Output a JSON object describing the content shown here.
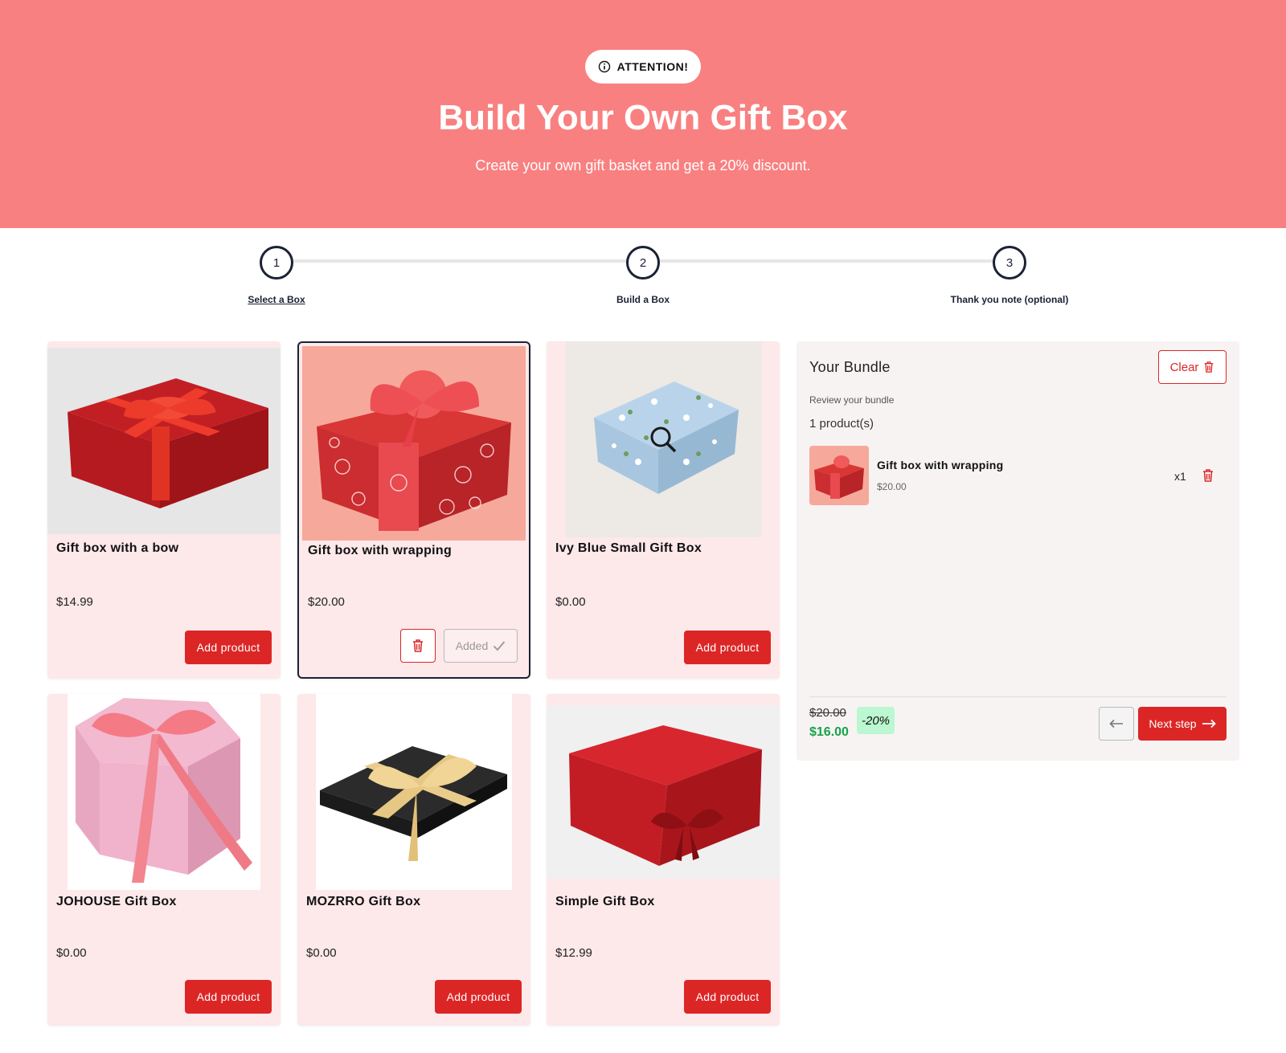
{
  "hero": {
    "badge": "ATTENTION!",
    "title": "Build Your Own Gift Box",
    "subtitle": "Create your own gift basket and get a 20% discount.",
    "color": "#f98080"
  },
  "steps": [
    {
      "number": "1",
      "label": "Select a Box",
      "active": true
    },
    {
      "number": "2",
      "label": "Build a Box",
      "active": false
    },
    {
      "number": "3",
      "label": "Thank you note (optional)",
      "active": false
    }
  ],
  "products": [
    {
      "name": "Gift box with a bow",
      "price": "$14.99",
      "button": "Add product",
      "added": false
    },
    {
      "name": "Gift box with wrapping",
      "price": "$20.00",
      "button": "Added",
      "added": true
    },
    {
      "name": "Ivy Blue Small Gift Box",
      "price": "$0.00",
      "button": "Add product",
      "added": false
    },
    {
      "name": "JOHOUSE Gift Box",
      "price": "$0.00",
      "button": "Add product",
      "added": false
    },
    {
      "name": "MOZRRO Gift Box",
      "price": "$0.00",
      "button": "Add product",
      "added": false
    },
    {
      "name": "Simple Gift Box",
      "price": "$12.99",
      "button": "Add product",
      "added": false
    }
  ],
  "bundle": {
    "title": "Your Bundle",
    "clear_label": "Clear",
    "review_text": "Review your bundle",
    "count_text": "1 product(s)",
    "items": [
      {
        "name": "Gift box with wrapping",
        "price": "$20.00",
        "qty": "x1"
      }
    ],
    "old_price": "$20.00",
    "new_price": "$16.00",
    "discount": "-20%",
    "next_label": "Next step"
  },
  "colors": {
    "accent": "#dc2626",
    "success": "#16a34a",
    "card_bg": "#fde8ea",
    "dark": "#1b2235"
  }
}
